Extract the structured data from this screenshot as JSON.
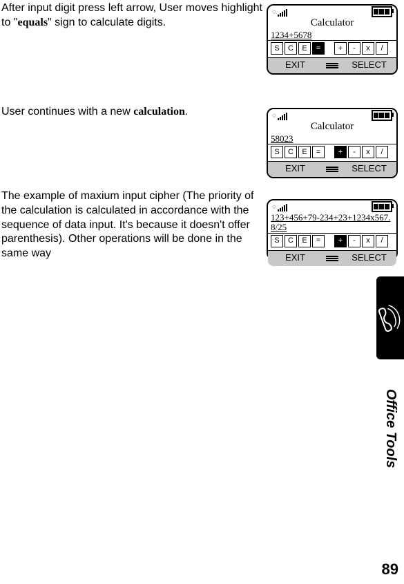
{
  "paragraphs": {
    "p1_a": "After input digit press left arrow, User moves highlight to \"",
    "p1_b": "equals",
    "p1_c": "\" sign to calculate digits.",
    "p2_a": "User continues with a new ",
    "p2_b": "calculation",
    "p2_c": ".",
    "p3": "The example of maxium input cipher (The priority of the calculation is calculated in accordance with the sequence of data input. It's because it doesn't offer parenthesis). Other operations will be done in the same way"
  },
  "screens": {
    "s1": {
      "title": "Calculator",
      "expression": "1234+5678",
      "highlight": "=",
      "exit": "EXIT",
      "select": "SELECT",
      "keys": {
        "k1": "S",
        "k2": "C",
        "k3": "E",
        "k4": "=",
        "k5": "+",
        "k6": "-",
        "k7": "x",
        "k8": "/"
      }
    },
    "s2": {
      "title": "Calculator",
      "expression": "58023",
      "highlight": "+",
      "exit": "EXIT",
      "select": "SELECT",
      "keys": {
        "k1": "S",
        "k2": "C",
        "k3": "E",
        "k4": "=",
        "k5": "+",
        "k6": "-",
        "k7": "x",
        "k8": "/"
      }
    },
    "s3": {
      "expression": "123+456+79-234+23+1234x567.8/25",
      "highlight": "+",
      "exit": "EXIT",
      "select": "SELECT",
      "keys": {
        "k1": "S",
        "k2": "C",
        "k3": "E",
        "k4": "=",
        "k5": "+",
        "k6": "-",
        "k7": "x",
        "k8": "/"
      }
    }
  },
  "side_label": "Office Tools",
  "page_number": "89"
}
